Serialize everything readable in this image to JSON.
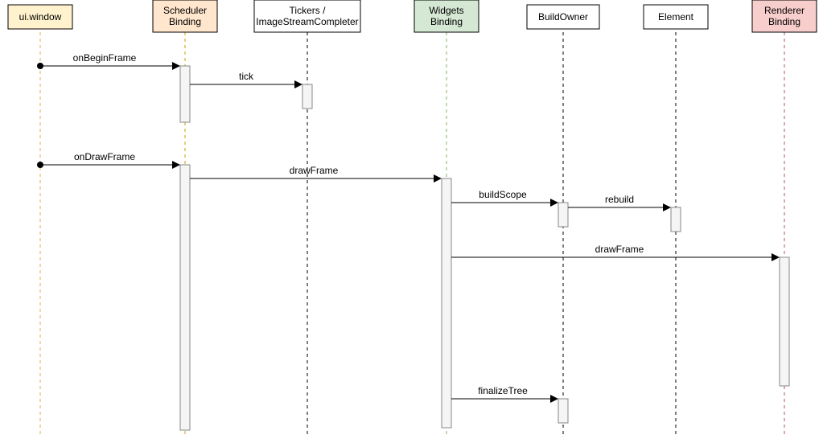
{
  "participants": {
    "ui_window": {
      "label": "ui.window"
    },
    "scheduler": {
      "label_line1": "Scheduler",
      "label_line2": "Binding"
    },
    "tickers": {
      "label_line1": "Tickers /",
      "label_line2": "ImageStreamCompleter"
    },
    "widgets": {
      "label_line1": "Widgets",
      "label_line2": "Binding"
    },
    "build_owner": {
      "label": "BuildOwner"
    },
    "element": {
      "label": "Element"
    },
    "renderer": {
      "label_line1": "Renderer",
      "label_line2": "Binding"
    }
  },
  "messages": {
    "onBeginFrame": "onBeginFrame",
    "tick": "tick",
    "onDrawFrame": "onDrawFrame",
    "drawFrame1": "drawFrame",
    "buildScope": "buildScope",
    "rebuild": "rebuild",
    "drawFrame2": "drawFrame",
    "finalizeTree": "finalizeTree"
  },
  "colors": {
    "ui_window_fill": "#fff2cc",
    "ui_window_stroke": "#d6b656",
    "scheduler_fill": "#ffe6cc",
    "scheduler_stroke": "#d79b00",
    "tickers_fill": "#ffffff",
    "tickers_stroke": "#000000",
    "widgets_fill": "#d5e8d4",
    "widgets_stroke": "#82b366",
    "build_owner_fill": "#ffffff",
    "build_owner_stroke": "#000000",
    "element_fill": "#ffffff",
    "element_stroke": "#000000",
    "renderer_fill": "#f8cecc",
    "renderer_stroke": "#b85450"
  }
}
